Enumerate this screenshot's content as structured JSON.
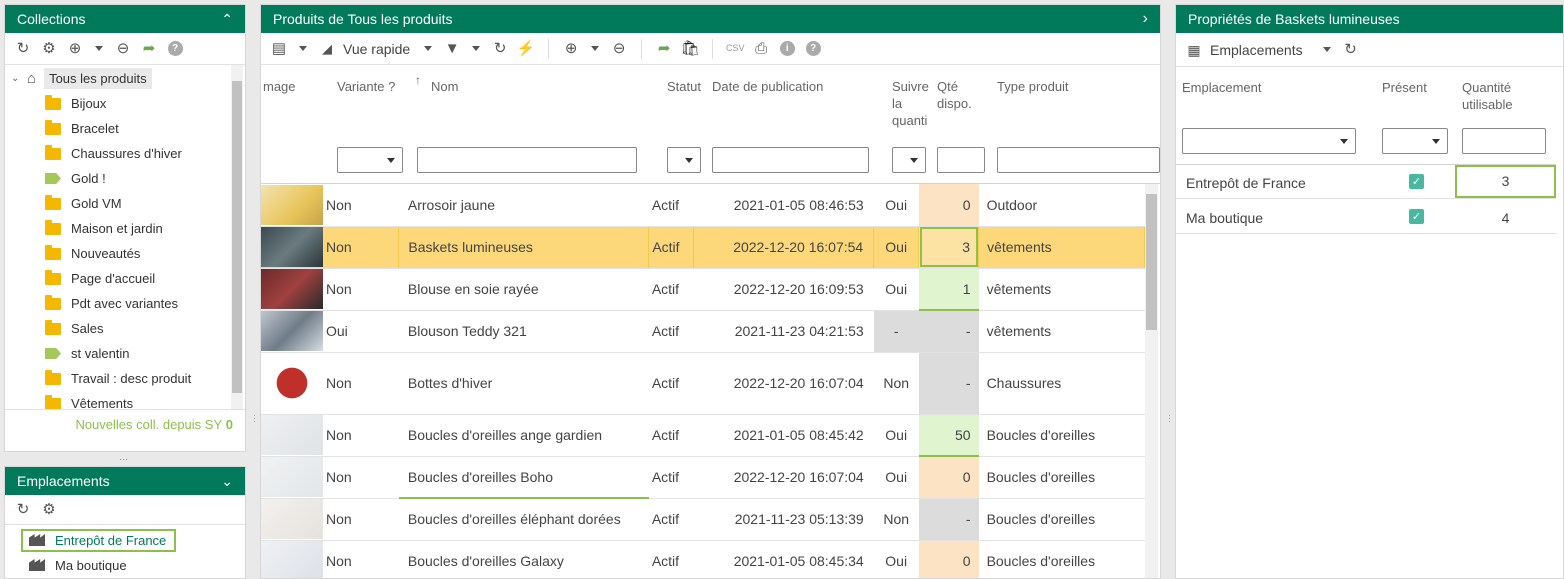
{
  "collections": {
    "title": "Collections",
    "tree_root": "Tous les produits",
    "items": [
      {
        "label": "Bijoux",
        "icon": "folder"
      },
      {
        "label": "Bracelet",
        "icon": "folder"
      },
      {
        "label": "Chaussures d'hiver",
        "icon": "folder"
      },
      {
        "label": "Gold !",
        "icon": "tag"
      },
      {
        "label": "Gold VM",
        "icon": "folder"
      },
      {
        "label": "Maison et jardin",
        "icon": "folder"
      },
      {
        "label": "Nouveautés",
        "icon": "folder"
      },
      {
        "label": "Page d'accueil",
        "icon": "folder"
      },
      {
        "label": "Pdt avec variantes",
        "icon": "folder"
      },
      {
        "label": "Sales",
        "icon": "folder"
      },
      {
        "label": "st valentin",
        "icon": "tag"
      },
      {
        "label": "Travail : desc produit",
        "icon": "folder"
      },
      {
        "label": "Vêtements",
        "icon": "folder"
      }
    ],
    "footer_text": "Nouvelles coll. depuis SY",
    "footer_count": "0"
  },
  "emplacements_left": {
    "title": "Emplacements",
    "items": [
      "Entrepôt de France",
      "Ma boutique"
    ]
  },
  "products": {
    "title": "Produits de Tous les produits",
    "quick_view": "Vue rapide",
    "columns": {
      "image": "mage",
      "variante": "Variante ?",
      "nom": "Nom",
      "statut": "Statut",
      "date": "Date de publication",
      "suivre": "Suivre la quanti",
      "qte": "Qté dispo.",
      "type": "Type produit"
    },
    "rows": [
      {
        "variante": "Non",
        "nom": "Arrosoir jaune",
        "statut": "Actif",
        "date": "2021-01-05 08:46:53",
        "suivre": "Oui",
        "qte": "0",
        "type": "Outdoor"
      },
      {
        "variante": "Non",
        "nom": "Baskets lumineuses",
        "statut": "Actif",
        "date": "2022-12-20 16:07:54",
        "suivre": "Oui",
        "qte": "3",
        "type": "vêtements"
      },
      {
        "variante": "Non",
        "nom": "Blouse en soie rayée",
        "statut": "Actif",
        "date": "2022-12-20 16:09:53",
        "suivre": "Oui",
        "qte": "1",
        "type": "vêtements"
      },
      {
        "variante": "Oui",
        "nom": "Blouson Teddy 321",
        "statut": "Actif",
        "date": "2021-11-23 04:21:53",
        "suivre": "-",
        "qte": "-",
        "type": "vêtements"
      },
      {
        "variante": "Non",
        "nom": "Bottes d'hiver",
        "statut": "Actif",
        "date": "2022-12-20 16:07:04",
        "suivre": "Non",
        "qte": "-",
        "type": "Chaussures"
      },
      {
        "variante": "Non",
        "nom": "Boucles d'oreilles ange gardien",
        "statut": "Actif",
        "date": "2021-01-05 08:45:42",
        "suivre": "Oui",
        "qte": "50",
        "type": "Boucles d'oreilles"
      },
      {
        "variante": "Non",
        "nom": "Boucles d'oreilles Boho",
        "statut": "Actif",
        "date": "2022-12-20 16:07:04",
        "suivre": "Oui",
        "qte": "0",
        "type": "Boucles d'oreilles"
      },
      {
        "variante": "Non",
        "nom": "Boucles d'oreilles éléphant dorées",
        "statut": "Actif",
        "date": "2021-11-23 05:13:39",
        "suivre": "Non",
        "qte": "-",
        "type": "Boucles d'oreilles"
      },
      {
        "variante": "Non",
        "nom": "Boucles d'oreilles Galaxy",
        "statut": "Actif",
        "date": "2021-01-05 08:45:34",
        "suivre": "Oui",
        "qte": "0",
        "type": "Boucles d'oreilles"
      }
    ]
  },
  "properties": {
    "title": "Propriétés de Baskets lumineuses",
    "toolbar_label": "Emplacements",
    "columns": {
      "emplacement": "Emplacement",
      "present": "Présent",
      "quantite": "Quantité utilisable"
    },
    "rows": [
      {
        "emplacement": "Entrepôt de France",
        "quantite": "3"
      },
      {
        "emplacement": "Ma boutique",
        "quantite": "4"
      }
    ]
  },
  "colors": {
    "brand": "#007a5a",
    "selected_row": "#fdd87a",
    "accent_green": "#8cc04b"
  }
}
